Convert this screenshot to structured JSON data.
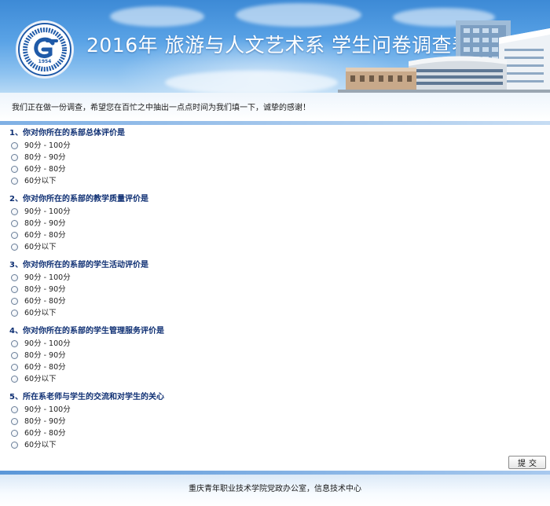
{
  "header": {
    "title": "2016年  旅游与人文艺术系  学生问卷调查表",
    "logo": {
      "year": "1954",
      "icon": "school-emblem"
    }
  },
  "intro": {
    "text": "我们正在做一份调查，希望您在百忙之中抽出一点点时间为我们填一下，诚挚的感谢！"
  },
  "questions": [
    {
      "title": "1、你对你所在的系部总体评价是",
      "options": [
        "90分 - 100分",
        "80分 - 90分",
        "60分 - 80分",
        "60分以下"
      ]
    },
    {
      "title": "2、你对你所在的系部的教学质量评价是",
      "options": [
        "90分 - 100分",
        "80分 - 90分",
        "60分 - 80分",
        "60分以下"
      ]
    },
    {
      "title": "3、你对你所在的系部的学生活动评价是",
      "options": [
        "90分 - 100分",
        "80分 - 90分",
        "60分 - 80分",
        "60分以下"
      ]
    },
    {
      "title": "4、你对你所在的系部的学生管理服务评价是",
      "options": [
        "90分 - 100分",
        "80分 - 90分",
        "60分 - 80分",
        "60分以下"
      ]
    },
    {
      "title": "5、所在系老师与学生的交流和对学生的关心",
      "options": [
        "90分 - 100分",
        "80分 - 90分",
        "60分 - 80分",
        "60分以下"
      ]
    }
  ],
  "actions": {
    "submit_label": "提交"
  },
  "footer": {
    "text": "重庆青年职业技术学院党政办公室，信息技术中心"
  },
  "colors": {
    "question_title": "#0e2f73",
    "banner_sky": "#5aa3e6",
    "divider": "#7fb0e4"
  }
}
